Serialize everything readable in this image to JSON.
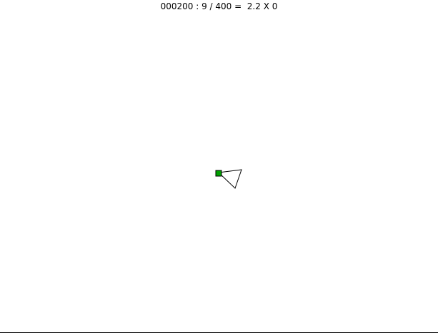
{
  "hud": {
    "status_text": "000200 : 9 / 400 =  2.2 X 0"
  },
  "sprites": {
    "ship": {
      "name": "ship-triangle",
      "stroke": "#000000",
      "fill": "#ffffff"
    },
    "marker": {
      "name": "green-square",
      "fill": "#00a000",
      "stroke": "#000000"
    }
  },
  "colors": {
    "background": "#ffffff",
    "ground_line": "#000000"
  }
}
